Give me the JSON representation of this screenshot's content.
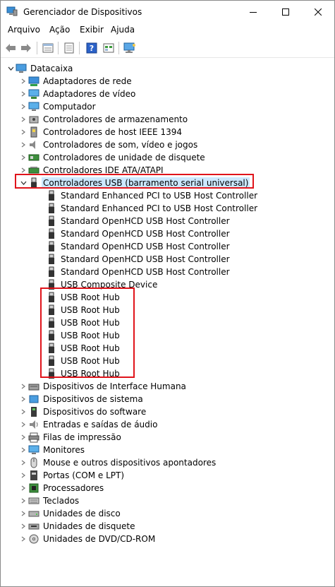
{
  "window": {
    "title": "Gerenciador de Dispositivos"
  },
  "menu": [
    "Arquivo",
    "Ação",
    "Exibir",
    "Ajuda"
  ],
  "toolbar": {
    "icons": [
      "back-arrow-icon",
      "forward-arrow-icon",
      "properties-view-icon",
      "document-view-icon",
      "help-icon",
      "refresh-view-icon",
      "monitor-scan-icon"
    ]
  },
  "tree": {
    "root": "Datacaixa",
    "categories": [
      "Adaptadores de rede",
      "Adaptadores de vídeo",
      "Computador",
      "Controladores de armazenamento",
      "Controladores de host IEEE 1394",
      "Controladores de som, vídeo e jogos",
      "Controladores de unidade de disquete",
      "Controladores IDE ATA/ATAPI",
      "Controladores USB (barramento serial universal)"
    ],
    "usb_children": [
      "Standard Enhanced PCI to USB Host Controller",
      "Standard Enhanced PCI to USB Host Controller",
      "Standard OpenHCD USB Host Controller",
      "Standard OpenHCD USB Host Controller",
      "Standard OpenHCD USB Host Controller",
      "Standard OpenHCD USB Host Controller",
      "Standard OpenHCD USB Host Controller",
      "USB Composite Device",
      "USB Root Hub",
      "USB Root Hub",
      "USB Root Hub",
      "USB Root Hub",
      "USB Root Hub",
      "USB Root Hub",
      "USB Root Hub"
    ],
    "more_categories": [
      "Dispositivos de Interface Humana",
      "Dispositivos de sistema",
      "Dispositivos do software",
      "Entradas e saídas de áudio",
      "Filas de impressão",
      "Monitores",
      "Mouse e outros dispositivos apontadores",
      "Portas (COM e LPT)",
      "Processadores",
      "Teclados",
      "Unidades de disco",
      "Unidades de disquete",
      "Unidades de DVD/CD-ROM"
    ]
  },
  "colors": {
    "highlight": "#e0141b",
    "selection": "#cce8ff"
  }
}
